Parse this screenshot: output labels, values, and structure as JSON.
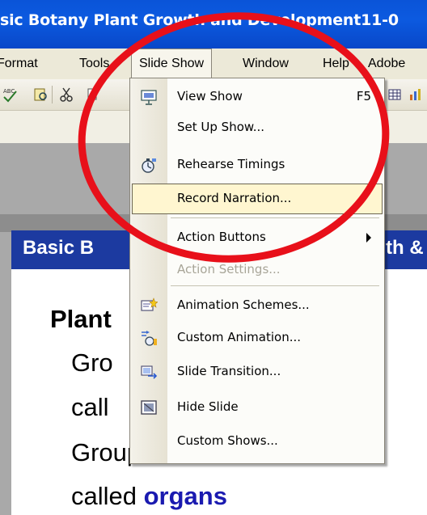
{
  "window": {
    "title": "sic Botany Plant Growth and Development11-0"
  },
  "menubar": {
    "items": [
      {
        "label": "Format"
      },
      {
        "label": "Tools"
      },
      {
        "label": "Slide Show",
        "active": true
      },
      {
        "label": "Window"
      },
      {
        "label": "Help"
      },
      {
        "label": "Adobe"
      }
    ]
  },
  "menu": {
    "items": [
      {
        "label": "View Show",
        "shortcut": "F5",
        "icon": "view-show-icon"
      },
      {
        "label": "Set Up Show..."
      },
      {
        "label": "Rehearse Timings",
        "icon": "stopwatch-icon"
      },
      {
        "label": "Record Narration...",
        "highlighted": true
      },
      {
        "label": "Action Buttons",
        "submenu": true
      },
      {
        "label": "Action Settings...",
        "disabled": true
      },
      {
        "label": "Animation Schemes...",
        "icon": "animation-schemes-icon"
      },
      {
        "label": "Custom Animation...",
        "icon": "custom-animation-icon"
      },
      {
        "label": "Slide Transition...",
        "icon": "slide-transition-icon"
      },
      {
        "label": "Hide Slide",
        "icon": "hide-slide-icon"
      },
      {
        "label": "Custom Shows..."
      }
    ]
  },
  "slide": {
    "header_left": "Basic B",
    "header_right": "th &",
    "lines": {
      "plant": "Plant",
      "gro": "Gro",
      "call": "call",
      "groups": "Groups of tissues are",
      "called": "called ",
      "organs": "organs"
    }
  },
  "colors": {
    "title_bar": "#0a54d8",
    "slide_header": "#1c3aa0",
    "annotation_circle": "#e8101a",
    "highlight": "#fff6d0"
  }
}
